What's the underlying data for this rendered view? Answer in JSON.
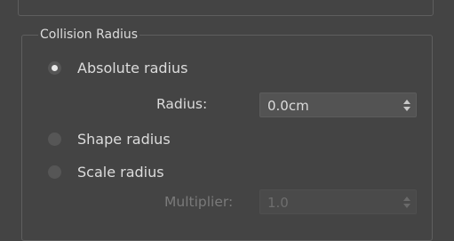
{
  "group": {
    "title": "Collision Radius"
  },
  "options": {
    "absolute_label": "Absolute radius",
    "shape_label": "Shape radius",
    "scale_label": "Scale radius",
    "selected": "absolute"
  },
  "radius": {
    "label": "Radius:",
    "value": "0.0cm"
  },
  "multiplier": {
    "label": "Multiplier:",
    "value": "1.0"
  },
  "colors": {
    "background": "#444444",
    "text": "#dcdcdc",
    "disabled_text": "#7a7a7a",
    "field_bg": "#535353"
  },
  "icons": {
    "spinner": "up-down-arrows-icon",
    "radio": "radio-circle-icon"
  }
}
